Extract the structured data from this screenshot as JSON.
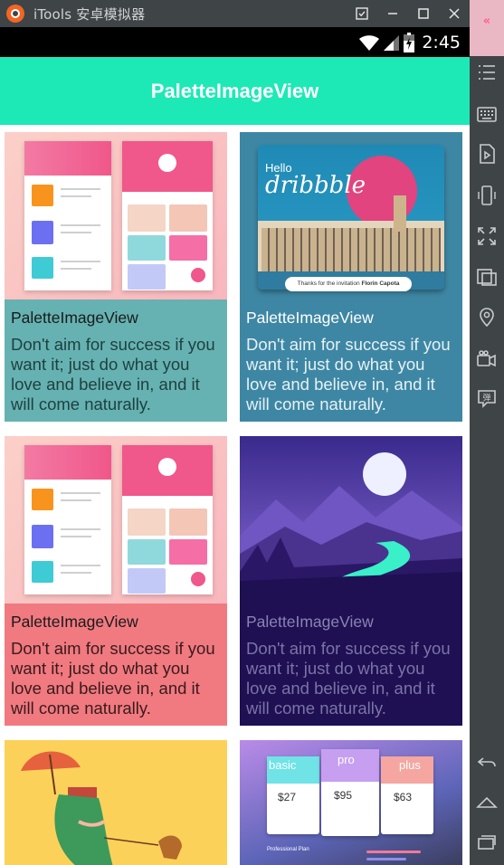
{
  "window": {
    "title": "iTools 安卓模拟器",
    "colors": {
      "chrome": "#3f4447",
      "accent": "#1de9b6"
    }
  },
  "statusbar": {
    "time": "2:45"
  },
  "appbar": {
    "title": "PaletteImageView"
  },
  "cards": [
    {
      "title": "PaletteImageView",
      "text": "Don't aim for success if you want it; just do what you love and believe in, and it will come naturally.",
      "image": "material-app-mockup",
      "background": "#66b2b2",
      "text_color": "#1a1a1a"
    },
    {
      "title": "PaletteImageView",
      "text": "Don't aim for success if you want it; just do what you love and believe in, and it will come naturally.",
      "image": "dribbble-invitation",
      "image_text": {
        "hello": "Hello",
        "brand": "dribbble",
        "invite": "Thanks for the invitation ",
        "invite_name": "Florin Capota"
      },
      "background": "#3e87a4",
      "text_color": "#ffffff"
    },
    {
      "title": "PaletteImageView",
      "text": "Don't aim for success if you want it; just do what you love and believe in, and it will come naturally.",
      "image": "material-app-mockup",
      "background": "#f07a80",
      "text_color": "#1a1a1a"
    },
    {
      "title": "PaletteImageView",
      "text": "Don't aim for success if you want it; just do what you love and believe in, and it will come naturally.",
      "image": "night-mountain-river",
      "background": "#1e1052",
      "text_color": "#8c82b4"
    },
    {
      "image": "umbrella-girl-illustration",
      "background": "#fcd15a"
    },
    {
      "image": "pricing-cards",
      "image_text": {
        "basic": "basic",
        "pro": "pro",
        "plus": "plus",
        "p1": "$27",
        "p2": "$95",
        "p3": "$63",
        "plan": "Professional Plan"
      },
      "background": "#3a3d5c"
    }
  ]
}
